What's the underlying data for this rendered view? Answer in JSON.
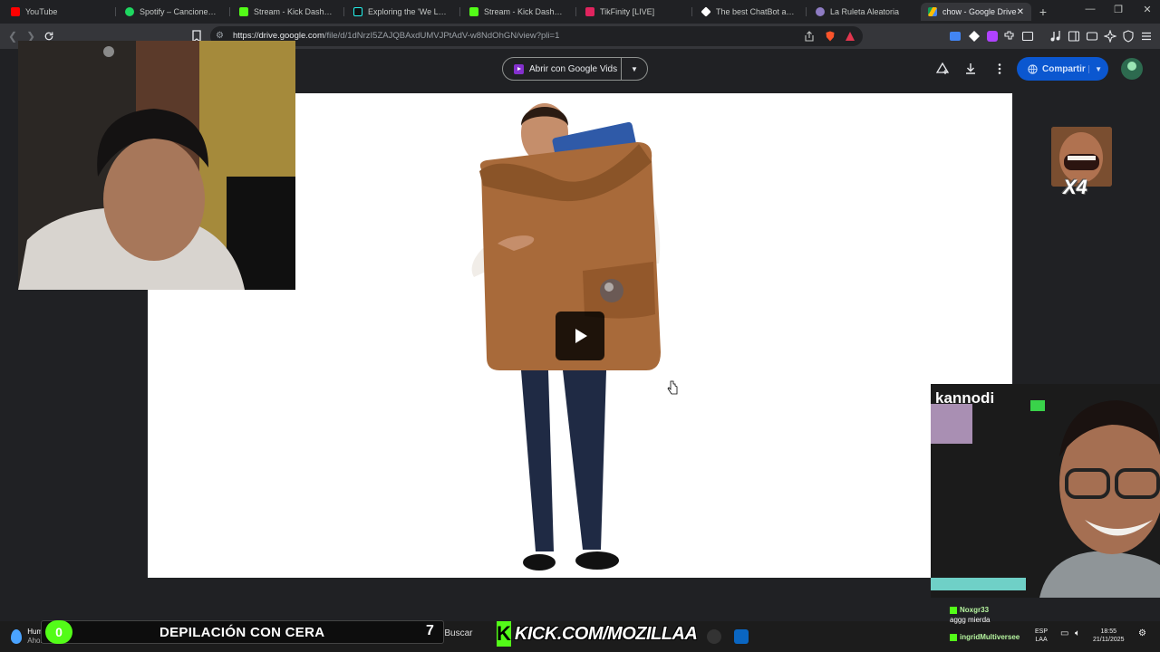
{
  "browser": {
    "tabs": [
      {
        "title": "YouTube",
        "favicon_color": "#ff0000"
      },
      {
        "title": "Spotify – Canciones que te",
        "favicon_color": "#1ed760"
      },
      {
        "title": "Stream - Kick Dashboard",
        "favicon_color": "#53fc18"
      },
      {
        "title": "Exploring the 'We Look Li",
        "favicon_color": "#111111"
      },
      {
        "title": "Stream - Kick Dashboard",
        "favicon_color": "#53fc18"
      },
      {
        "title": "TikFinity [LIVE]",
        "favicon_color": "#e0245e"
      },
      {
        "title": "The best ChatBot and Wid",
        "favicon_color": "#ffffff"
      },
      {
        "title": "La Ruleta Aleatoria",
        "favicon_color": "#8e7cc3"
      },
      {
        "title": "chow - Google Drive",
        "favicon_color": "#4285f4"
      }
    ],
    "url_host": "https://drive.google.com",
    "url_path": "/file/d/1dNrzI5ZAJQBAxdUMVJPtAdV-w8NdOhGN/view?pli=1"
  },
  "drive": {
    "open_with_label": "Abrir con Google Vids",
    "share_label": "Compartir"
  },
  "stream": {
    "cam2_name": "kannodi",
    "emote_multiplier": "X4",
    "counter": "0",
    "banner_text": "DEPILACIÓN CON CERA",
    "banner_number": "7",
    "kick_url": "KICK.COM/MOZILLAA",
    "chat": [
      {
        "user": "Noxgr33",
        "text": "aggg mierda"
      },
      {
        "user": "ingridMultiversee",
        "text": ""
      }
    ]
  },
  "taskbar": {
    "weather_label": "Hum",
    "weather_sub": "Ahora",
    "search_label": "Buscar",
    "lang": "ESP",
    "lang_sub": "LAA",
    "time": "18:55",
    "date": "21/11/2025"
  },
  "colors": {
    "kick_green": "#53fc18",
    "share_blue": "#0b57d0"
  }
}
